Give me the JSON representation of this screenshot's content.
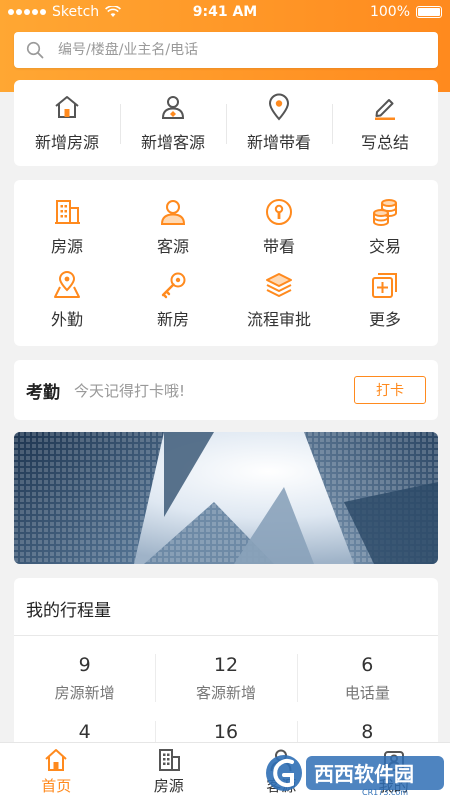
{
  "status_bar": {
    "carrier": "Sketch",
    "time": "9:41 AM",
    "battery": "100%"
  },
  "search": {
    "placeholder": "编号/楼盘/业主名/电话"
  },
  "quick_actions": [
    {
      "label": "新增房源",
      "icon": "house-icon"
    },
    {
      "label": "新增客源",
      "icon": "person-icon"
    },
    {
      "label": "新增带看",
      "icon": "location-pin-icon"
    },
    {
      "label": "写总结",
      "icon": "pen-icon"
    }
  ],
  "modules": [
    {
      "label": "房源",
      "icon": "building-icon"
    },
    {
      "label": "客源",
      "icon": "customer-icon"
    },
    {
      "label": "带看",
      "icon": "keyhole-icon"
    },
    {
      "label": "交易",
      "icon": "coins-icon"
    },
    {
      "label": "外勤",
      "icon": "map-pin-icon"
    },
    {
      "label": "新房",
      "icon": "key-icon"
    },
    {
      "label": "流程审批",
      "icon": "layers-icon"
    },
    {
      "label": "更多",
      "icon": "add-icon"
    }
  ],
  "checkin": {
    "title": "考勤",
    "hint": "今天记得打卡哦!",
    "button": "打卡"
  },
  "stats": {
    "title": "我的行程量",
    "items": [
      {
        "value": "9",
        "label": "房源新增"
      },
      {
        "value": "12",
        "label": "客源新增"
      },
      {
        "value": "6",
        "label": "电话量"
      },
      {
        "value": "4",
        "label": ""
      },
      {
        "value": "16",
        "label": ""
      },
      {
        "value": "8",
        "label": ""
      }
    ]
  },
  "tabbar": [
    {
      "label": "首页",
      "icon": "home-icon",
      "active": true
    },
    {
      "label": "房源",
      "icon": "building-icon",
      "active": false
    },
    {
      "label": "客源",
      "icon": "customer-icon",
      "active": false
    },
    {
      "label": "我的",
      "icon": "profile-icon",
      "active": false
    }
  ],
  "colors": {
    "accent": "#ff8a1e",
    "header_start": "#ffa733",
    "background": "#f2f2f2"
  },
  "watermark": {
    "text": "西西软件园",
    "subtext": "CR173.com"
  }
}
